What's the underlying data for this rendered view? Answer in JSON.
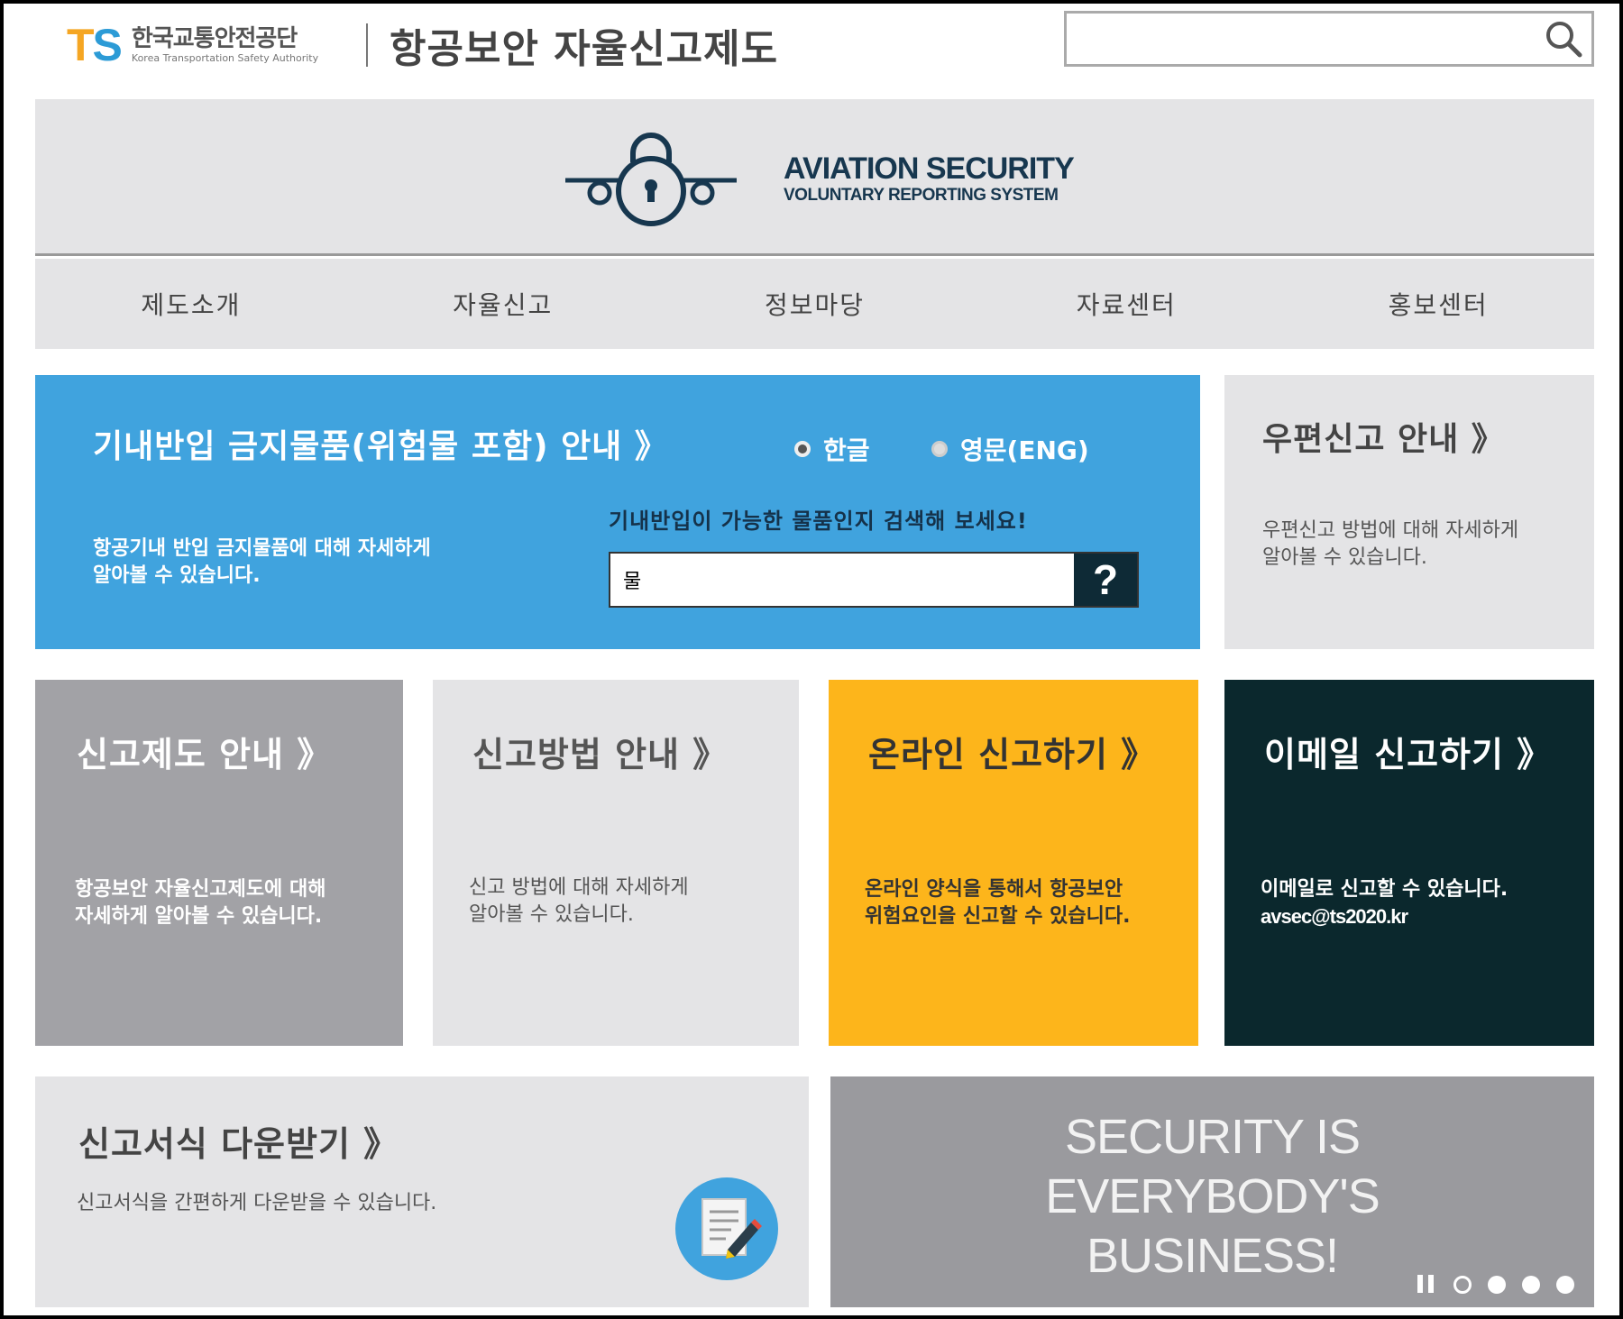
{
  "header": {
    "logo_mark_t": "T",
    "logo_mark_s": "S",
    "org_name_ko": "한국교통안전공단",
    "org_name_en": "Korea Transportation Safety Authority",
    "site_title": "항공보안 자율신고제도",
    "search": {
      "value": "",
      "placeholder": ""
    }
  },
  "banner": {
    "title_line1": "AVIATION SECURITY",
    "title_line2": "VOLUNTARY REPORTING SYSTEM",
    "color": "#17374f"
  },
  "nav": {
    "items": [
      {
        "label": "제도소개"
      },
      {
        "label": "자율신고"
      },
      {
        "label": "정보마당"
      },
      {
        "label": "자료센터"
      },
      {
        "label": "홍보센터"
      }
    ]
  },
  "tiles": {
    "prohibited": {
      "title": "기내반입 금지물품(위험물 포함) 안내 》",
      "desc": "항공기내 반입 금지물품에 대해 자세하게\n알아볼 수 있습니다.",
      "lang_options": [
        "한글",
        "영문(ENG)"
      ],
      "lang_selected": "한글",
      "search_hint": "기내반입이 가능한 물품인지 검색해 보세요!",
      "search_value": "물",
      "search_button": "?",
      "color": "#40a3de"
    },
    "postal": {
      "title": "우편신고 안내 》",
      "desc": "우편신고 방법에 대해 자세하게\n알아볼 수 있습니다."
    },
    "guide": {
      "title": "신고제도 안내 》",
      "desc": "항공보안 자율신고제도에 대해\n자세하게 알아볼 수 있습니다.",
      "color": "#a2a2a6"
    },
    "method": {
      "title": "신고방법 안내 》",
      "desc": "신고 방법에 대해 자세하게\n알아볼 수 있습니다."
    },
    "online": {
      "title": "온라인 신고하기 》",
      "desc": "온라인 양식을 통해서 항공보안\n위험요인을 신고할 수 있습니다.",
      "color": "#fdb51b"
    },
    "email": {
      "title": "이메일 신고하기 》",
      "desc": "이메일로 신고할 수 있습니다.",
      "address": "avsec@ts2020.kr",
      "color": "#0b282d"
    },
    "forms": {
      "title": "신고서식 다운받기 》",
      "desc": "신고서식을 간편하게 다운받을 수 있습니다.",
      "icon": "document-edit-icon"
    },
    "slogan": {
      "line1": "SECURITY IS",
      "line2": "EVERYBODY'S",
      "line3": "BUSINESS!",
      "slide_count": 4,
      "active_slide": 1,
      "playing": true
    }
  }
}
